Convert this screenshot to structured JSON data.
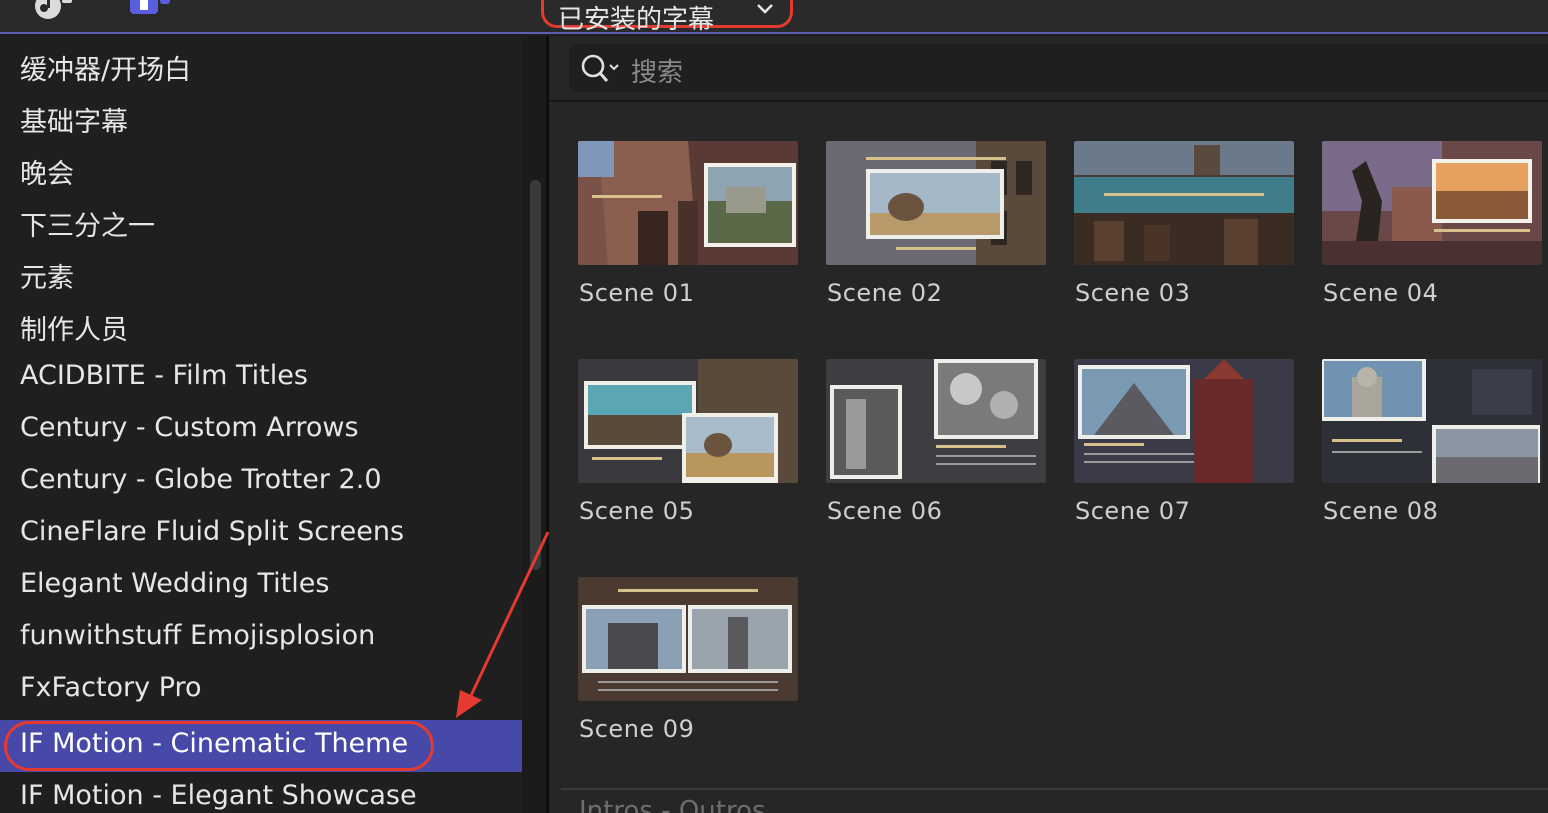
{
  "header": {
    "dropdown_label": "已安装的字幕",
    "icons": [
      "music-note-icon",
      "title-icon",
      "chevron-down-icon"
    ],
    "accent": "#5b5fb8",
    "annotation_color": "#e53a2f"
  },
  "sidebar": {
    "items": [
      {
        "label": "缓冲器/开场白"
      },
      {
        "label": "基础字幕"
      },
      {
        "label": "晚会"
      },
      {
        "label": "下三分之一"
      },
      {
        "label": "元素"
      },
      {
        "label": "制作人员"
      },
      {
        "label": "ACIDBITE - Film Titles"
      },
      {
        "label": "Century - Custom Arrows"
      },
      {
        "label": "Century - Globe Trotter 2.0"
      },
      {
        "label": "CineFlare Fluid Split Screens"
      },
      {
        "label": "Elegant Wedding Titles"
      },
      {
        "label": "funwithstuff Emojisplosion"
      },
      {
        "label": "FxFactory Pro"
      },
      {
        "label": "IF Motion - Cinematic Theme",
        "selected": true
      },
      {
        "label": "IF Motion - Elegant Showcase"
      }
    ],
    "selected_color": "#4749a8"
  },
  "search": {
    "placeholder": "搜索",
    "icon": "search-icon"
  },
  "browser": {
    "tiles": [
      {
        "label": "Scene 01"
      },
      {
        "label": "Scene 02"
      },
      {
        "label": "Scene 03"
      },
      {
        "label": "Scene 04"
      },
      {
        "label": "Scene 05"
      },
      {
        "label": "Scene 06"
      },
      {
        "label": "Scene 07"
      },
      {
        "label": "Scene 08"
      },
      {
        "label": "Scene 09"
      }
    ],
    "next_section_title": "Intros - Outros"
  }
}
